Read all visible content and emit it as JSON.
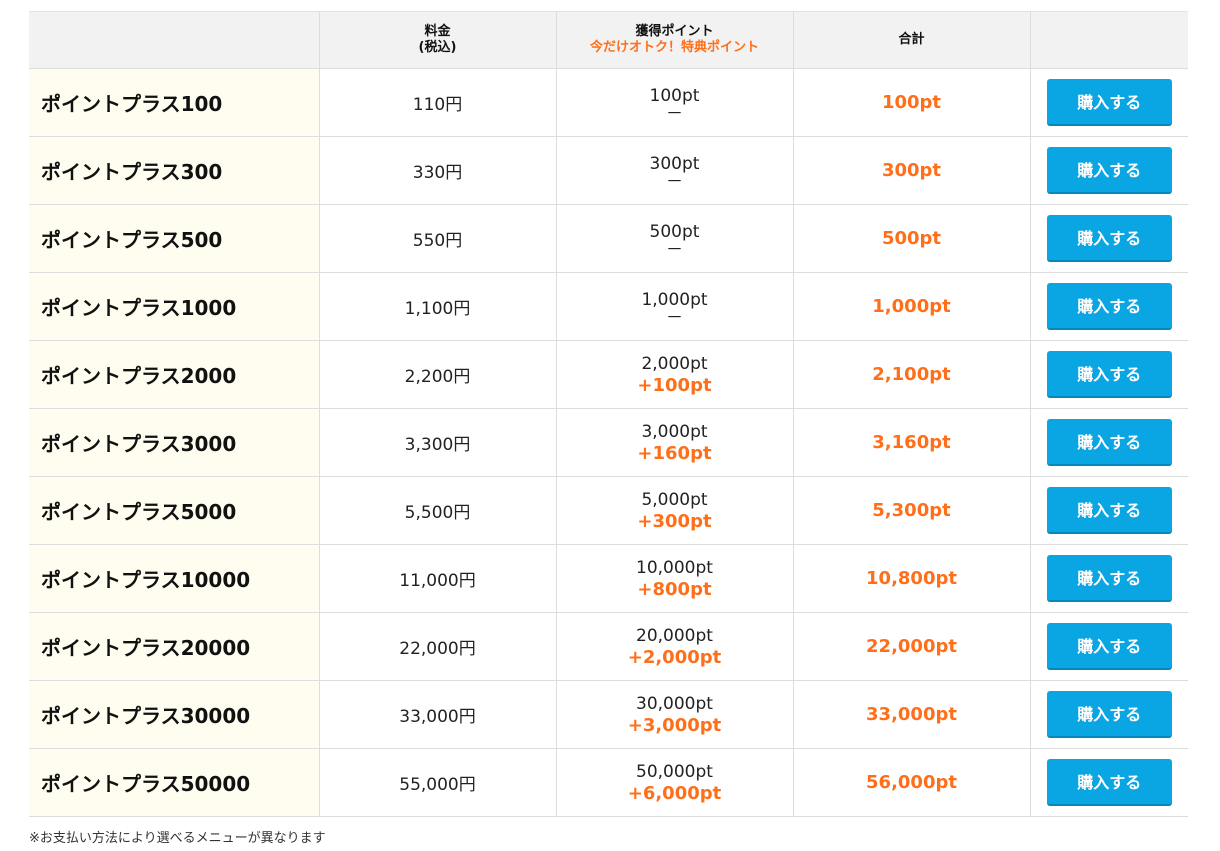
{
  "header": {
    "col_plan": "",
    "col_fee_line1": "料金",
    "col_fee_line2": "(税込)",
    "col_gain": "獲得ポイント",
    "col_gain_sub": "今だけオトク！特典ポイント",
    "col_total": "合計",
    "col_action": ""
  },
  "rows": [
    {
      "name": "ポイントプラス100",
      "fee": "110円",
      "base": "100pt",
      "bonus": "",
      "dash": "－",
      "total": "100pt",
      "button": "購入する"
    },
    {
      "name": "ポイントプラス300",
      "fee": "330円",
      "base": "300pt",
      "bonus": "",
      "dash": "－",
      "total": "300pt",
      "button": "購入する"
    },
    {
      "name": "ポイントプラス500",
      "fee": "550円",
      "base": "500pt",
      "bonus": "",
      "dash": "－",
      "total": "500pt",
      "button": "購入する"
    },
    {
      "name": "ポイントプラス1000",
      "fee": "1,100円",
      "base": "1,000pt",
      "bonus": "",
      "dash": "－",
      "total": "1,000pt",
      "button": "購入する"
    },
    {
      "name": "ポイントプラス2000",
      "fee": "2,200円",
      "base": "2,000pt",
      "bonus": "+100pt",
      "dash": "",
      "total": "2,100pt",
      "button": "購入する"
    },
    {
      "name": "ポイントプラス3000",
      "fee": "3,300円",
      "base": "3,000pt",
      "bonus": "+160pt",
      "dash": "",
      "total": "3,160pt",
      "button": "購入する"
    },
    {
      "name": "ポイントプラス5000",
      "fee": "5,500円",
      "base": "5,000pt",
      "bonus": "+300pt",
      "dash": "",
      "total": "5,300pt",
      "button": "購入する"
    },
    {
      "name": "ポイントプラス10000",
      "fee": "11,000円",
      "base": "10,000pt",
      "bonus": "+800pt",
      "dash": "",
      "total": "10,800pt",
      "button": "購入する"
    },
    {
      "name": "ポイントプラス20000",
      "fee": "22,000円",
      "base": "20,000pt",
      "bonus": "+2,000pt",
      "dash": "",
      "total": "22,000pt",
      "button": "購入する"
    },
    {
      "name": "ポイントプラス30000",
      "fee": "33,000円",
      "base": "30,000pt",
      "bonus": "+3,000pt",
      "dash": "",
      "total": "33,000pt",
      "button": "購入する"
    },
    {
      "name": "ポイントプラス50000",
      "fee": "55,000円",
      "base": "50,000pt",
      "bonus": "+6,000pt",
      "dash": "",
      "total": "56,000pt",
      "button": "購入する"
    }
  ],
  "footer": {
    "note": "※お支払い方法により選べるメニューが異なります"
  },
  "colors": {
    "accent_orange": "#ff6f1a",
    "button_blue": "#0aa5e3",
    "name_bg": "#fffdf0",
    "header_bg": "#f2f2f2"
  }
}
